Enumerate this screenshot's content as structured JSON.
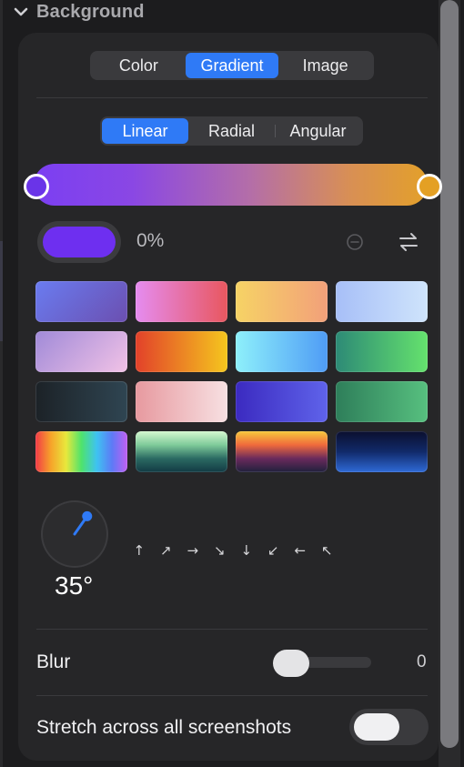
{
  "section": {
    "title": "Background",
    "collapse_icon": "chevron-down-icon"
  },
  "background_type": {
    "options": [
      "Color",
      "Gradient",
      "Image"
    ],
    "selected": "Gradient"
  },
  "gradient_type": {
    "options": [
      "Linear",
      "Radial",
      "Angular"
    ],
    "selected": "Linear"
  },
  "gradient": {
    "start_color": "#6a34e8",
    "end_color": "#e4a024"
  },
  "selected_stop": {
    "color": "#6e2ff0",
    "position": "0%",
    "remove_icon": "minus-circle-icon",
    "swap_icon": "swap-arrows-icon"
  },
  "presets": [
    "linear-gradient(135deg,#6a7cf0,#6b4fb0)",
    "linear-gradient(90deg,#e58cf0,#e8575f)",
    "linear-gradient(90deg,#f6d365,#f2a07a)",
    "linear-gradient(90deg,#a7bff8,#cfe4fb)",
    "linear-gradient(135deg,#a08ad8,#f1c2e6)",
    "linear-gradient(90deg,#e2412a,#f5c61e)",
    "linear-gradient(90deg,#8ef0fb,#4f9cf5)",
    "linear-gradient(90deg,#2d8a76,#65e26d)",
    "linear-gradient(90deg,#1c2227,#2f4552)",
    "linear-gradient(90deg,#e7999f,#f7e0e2)",
    "linear-gradient(90deg,#3b2ac0,#5f63ea)",
    "linear-gradient(90deg,#2e7e5a,#57c07f)",
    "linear-gradient(90deg,#f23a47,#f6a32a,#e8e83c,#4ee36c,#3ec3f1,#5d7af6,#c060f4)",
    "linear-gradient(180deg,#d5f7d0,#7fcb9a,#2b6a62,#123a44)",
    "linear-gradient(180deg,#f6c93c,#f06a3c,#6a2a5c,#20203c)",
    "linear-gradient(180deg,#0b0f2e,#112a6a,#2f6ad6)"
  ],
  "angle": {
    "value": "35°",
    "degrees": 35,
    "directions": [
      "↑",
      "↗",
      "→",
      "↘",
      "↓",
      "↙",
      "←",
      "↖"
    ]
  },
  "blur": {
    "label": "Blur",
    "value": "0",
    "level": 0
  },
  "stretch": {
    "label": "Stretch across all screenshots",
    "enabled": false
  }
}
